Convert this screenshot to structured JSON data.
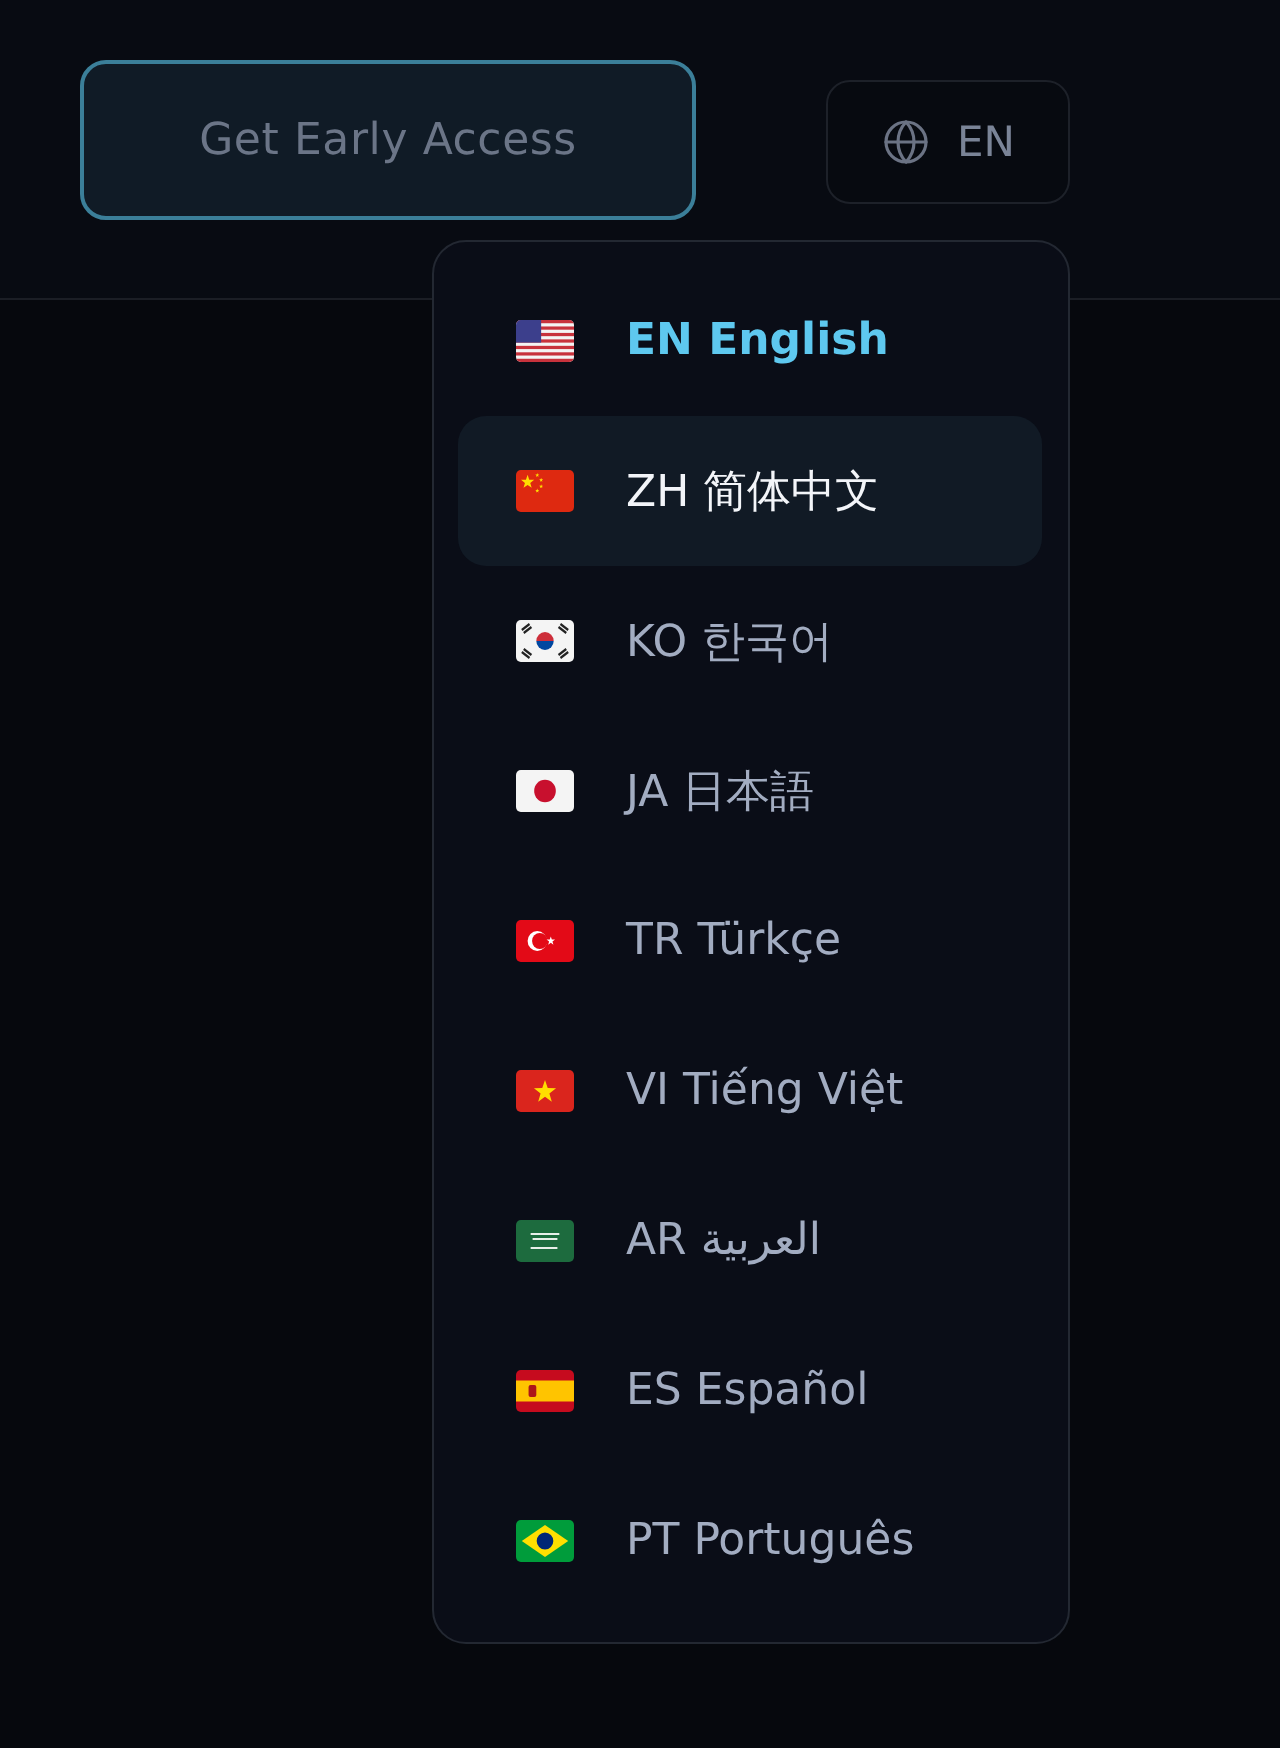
{
  "header": {
    "cta_button": {
      "label": "Get Early Access"
    },
    "language_button": {
      "label": "EN"
    }
  },
  "language_menu": {
    "items": [
      {
        "kind": "us",
        "label": "EN English",
        "selected": true,
        "highlighted": false
      },
      {
        "kind": "cn",
        "label": "ZH 简体中文",
        "selected": false,
        "highlighted": true
      },
      {
        "kind": "kr",
        "label": "KO 한국어",
        "selected": false,
        "highlighted": false
      },
      {
        "kind": "jp",
        "label": "JA 日本語",
        "selected": false,
        "highlighted": false
      },
      {
        "kind": "tr",
        "label": "TR Türkçe",
        "selected": false,
        "highlighted": false
      },
      {
        "kind": "vn",
        "label": "VI Tiếng Việt",
        "selected": false,
        "highlighted": false
      },
      {
        "kind": "sa",
        "label": "AR العربية",
        "selected": false,
        "highlighted": false
      },
      {
        "kind": "es",
        "label": "ES Español",
        "selected": false,
        "highlighted": false
      },
      {
        "kind": "br",
        "label": "PT Português",
        "selected": false,
        "highlighted": false
      }
    ]
  }
}
